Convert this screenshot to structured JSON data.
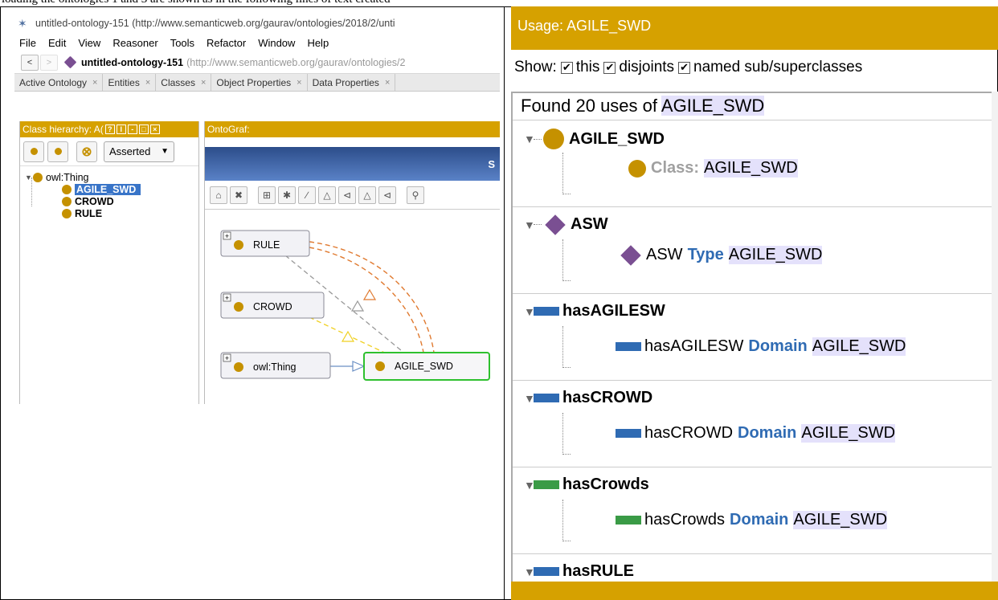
{
  "caption": "loading the ontologies 1 and 3 are shown as in the following lines of text created",
  "protege": {
    "window_title": "untitled-ontology-151 (http://www.semanticweb.org/gaurav/ontologies/2018/2/unti",
    "menu": [
      "File",
      "Edit",
      "View",
      "Reasoner",
      "Tools",
      "Refactor",
      "Window",
      "Help"
    ],
    "address": {
      "back": "<",
      "forward": ">",
      "ontology_name": "untitled-ontology-151",
      "ontology_url": "(http://www.semanticweb.org/gaurav/ontologies/2"
    },
    "tabs": [
      "Active Ontology",
      "Entities",
      "Classes",
      "Object Properties",
      "Data Properties"
    ],
    "tab_close": "×",
    "class_hierarchy": {
      "header": "Class hierarchy: A(",
      "header_buttons": [
        "?",
        "I",
        "-",
        "□",
        "×"
      ],
      "mode": "Asserted",
      "root": "owl:Thing",
      "children": [
        "AGILE_SWD",
        "CROWD",
        "RULE"
      ],
      "selected": "AGILE_SWD"
    },
    "ontograf": {
      "header": "OntoGraf:",
      "band_text": "S",
      "nodes": [
        "RULE",
        "CROWD",
        "owl:Thing",
        "AGILE_SWD"
      ],
      "expand_glyph": "+"
    }
  },
  "usage": {
    "header": "Usage: AGILE_SWD",
    "show_label": "Show:",
    "check_mark": "✔",
    "options": [
      "this",
      "disjoints",
      "named sub/superclasses"
    ],
    "found_prefix": "Found 20 uses of",
    "found_entity": "AGILE_SWD",
    "groups": [
      {
        "head": "AGILE_SWD",
        "kind": "class",
        "item_keyword": "Class:",
        "item_subject": "",
        "item_object": "AGILE_SWD"
      },
      {
        "head": "ASW",
        "kind": "individual",
        "item_subject": "ASW",
        "item_keyword": "Type",
        "item_object": "AGILE_SWD"
      },
      {
        "head": "hasAGILESW",
        "kind": "object-property",
        "item_subject": "hasAGILESW",
        "item_keyword": "Domain",
        "item_object": "AGILE_SWD"
      },
      {
        "head": "hasCROWD",
        "kind": "object-property",
        "item_subject": "hasCROWD",
        "item_keyword": "Domain",
        "item_object": "AGILE_SWD"
      },
      {
        "head": "hasCrowds",
        "kind": "data-property",
        "item_subject": "hasCrowds",
        "item_keyword": "Domain",
        "item_object": "AGILE_SWD"
      },
      {
        "head": "hasRULE",
        "kind": "object-property"
      }
    ]
  },
  "colors": {
    "header_gold": "#d6a100",
    "class_dot": "#c59100",
    "individual": "#7a4f92",
    "object_property": "#2f6bb3",
    "data_property": "#3a9b46",
    "highlight": "#e4e1fb"
  }
}
